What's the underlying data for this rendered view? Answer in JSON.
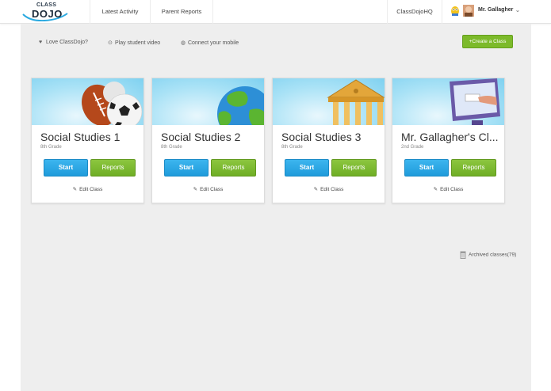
{
  "header": {
    "logo_top": "CLASS",
    "logo_main": "DOJO",
    "nav": {
      "latest_activity": "Latest Activity",
      "parent_reports": "Parent Reports",
      "hq": "ClassDojoHQ"
    },
    "user": {
      "name": "Mr. Gallagher",
      "chevron": "⌄"
    }
  },
  "toolbar": {
    "love": {
      "icon": "heart-icon",
      "label": "Love ClassDojo?"
    },
    "video": {
      "icon": "play-icon",
      "label": "Play student video"
    },
    "mobile": {
      "icon": "globe-icon",
      "label": "Connect your mobile"
    },
    "create_label": "+Create a Class"
  },
  "classes": [
    {
      "title": "Social Studies 1",
      "grade": "8th Grade",
      "start": "Start",
      "reports": "Reports",
      "edit": "Edit Class",
      "banner": "sports-balls"
    },
    {
      "title": "Social Studies 2",
      "grade": "8th Grade",
      "start": "Start",
      "reports": "Reports",
      "edit": "Edit Class",
      "banner": "globe"
    },
    {
      "title": "Social Studies 3",
      "grade": "8th Grade",
      "start": "Start",
      "reports": "Reports",
      "edit": "Edit Class",
      "banner": "greek-temple"
    },
    {
      "title": "Mr. Gallagher's Cl...",
      "grade": "2nd Grade",
      "start": "Start",
      "reports": "Reports",
      "edit": "Edit Class",
      "banner": "computer-screen"
    }
  ],
  "archived": {
    "label": "Archived classes(79)",
    "icon": "trash-icon"
  },
  "colors": {
    "start_blue": "#1f9bdb",
    "reports_green": "#6fae25",
    "create_green": "#7cba2a",
    "banner_sky": "#a9e2f6"
  }
}
